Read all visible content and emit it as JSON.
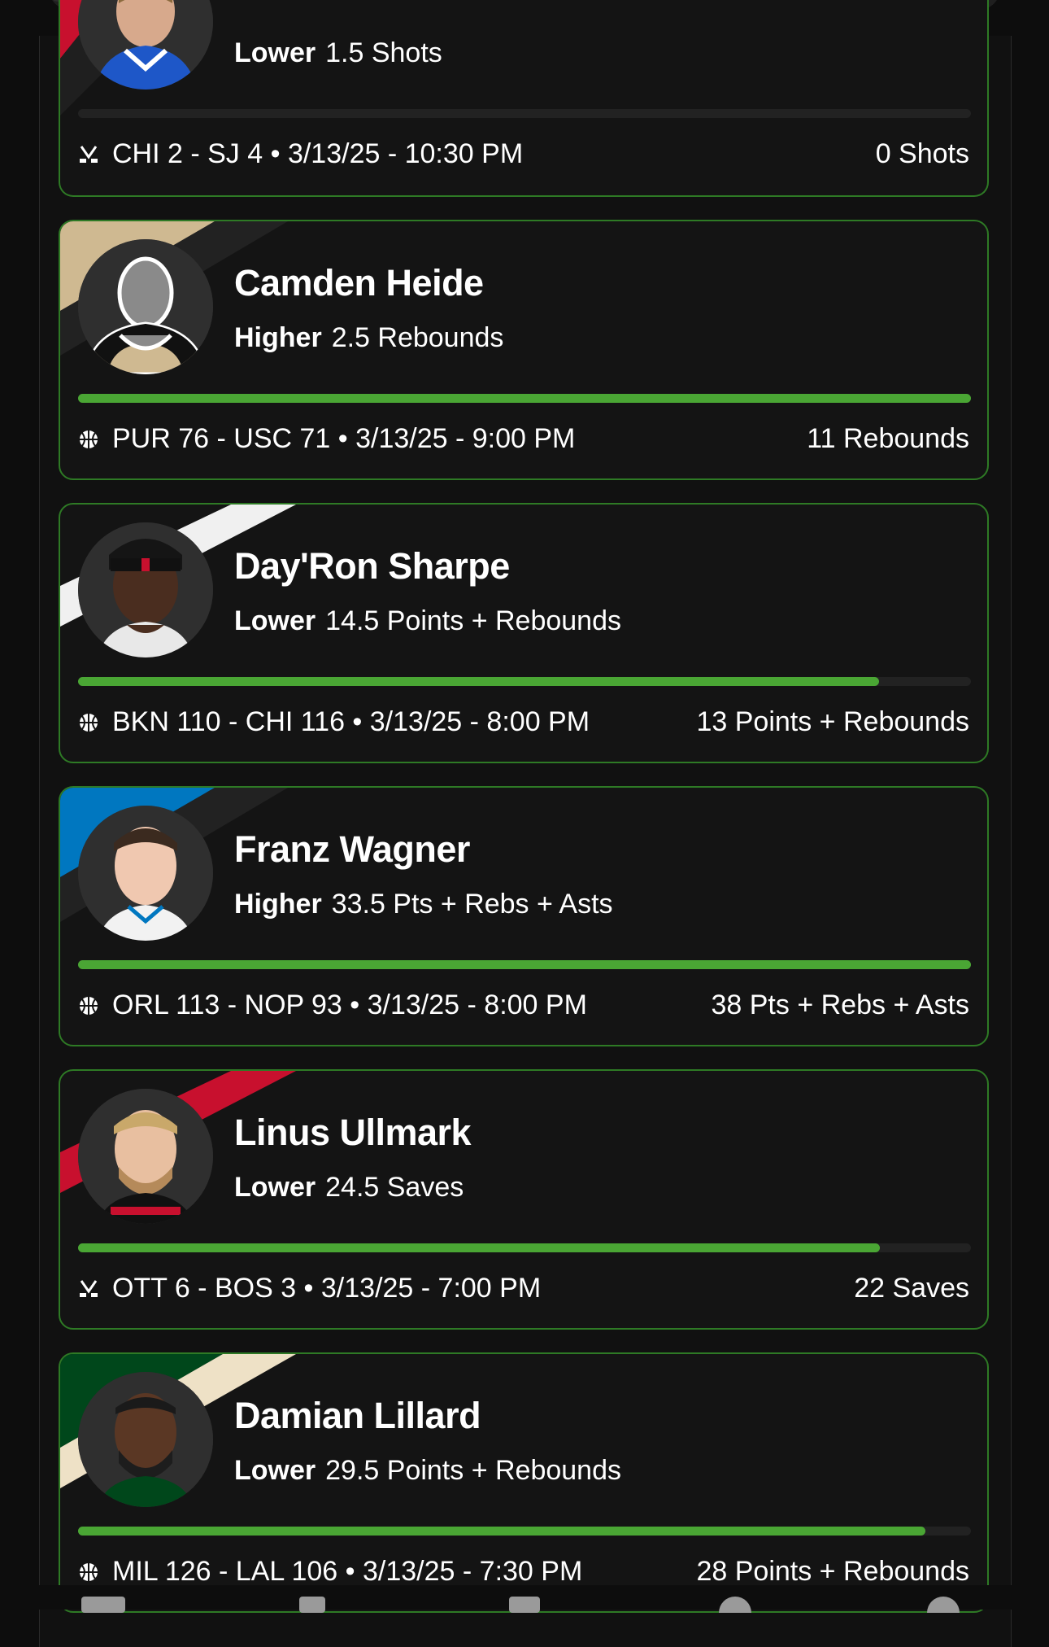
{
  "cards": [
    {
      "name": "",
      "direction": "Lower",
      "line": "1.5 Shots",
      "sport": "hockey-icon",
      "game": "CHI 2 - SJ 4 • 3/13/25 - 10:30 PM",
      "result": "0 Shots",
      "progress": 0.0,
      "stripe_colors": [
        "#c8102e",
        "#1f1f1f"
      ]
    },
    {
      "name": "Camden Heide",
      "direction": "Higher",
      "line": "2.5 Rebounds",
      "sport": "basketball-icon",
      "game": "PUR 76 - USC 71 • 3/13/25 - 9:00 PM",
      "result": "11 Rebounds",
      "progress": 1.0,
      "stripe_colors": [
        "#cfb991",
        "#222222"
      ]
    },
    {
      "name": "Day'Ron Sharpe",
      "direction": "Lower",
      "line": "14.5 Points + Rebounds",
      "sport": "basketball-icon",
      "game": "BKN 110 - CHI 116 • 3/13/25 - 8:00 PM",
      "result": "13 Points + Rebounds",
      "progress": 0.897,
      "stripe_colors": [
        "#f0f0f0",
        "#111111"
      ]
    },
    {
      "name": "Franz Wagner",
      "direction": "Higher",
      "line": "33.5 Pts + Rebs + Asts",
      "sport": "basketball-icon",
      "game": "ORL 113 - NOP 93 • 3/13/25 - 8:00 PM",
      "result": "38 Pts + Rebs + Asts",
      "progress": 1.0,
      "stripe_colors": [
        "#0077c0",
        "#222222"
      ]
    },
    {
      "name": "Linus Ullmark",
      "direction": "Lower",
      "line": "24.5 Saves",
      "sport": "hockey-icon",
      "game": "OTT 6 - BOS 3 • 3/13/25 - 7:00 PM",
      "result": "22 Saves",
      "progress": 0.898,
      "stripe_colors": [
        "#c8102e",
        "#111111"
      ]
    },
    {
      "name": "Damian Lillard",
      "direction": "Lower",
      "line": "29.5 Points + Rebounds",
      "sport": "basketball-icon",
      "game": "MIL 126 - LAL 106 • 3/13/25 - 7:30 PM",
      "result": "28 Points + Rebounds",
      "progress": 0.949,
      "stripe_colors": [
        "#00471b",
        "#eee1c6"
      ]
    }
  ],
  "colors": {
    "accent": "#4aa634",
    "border": "#2e7a25",
    "background": "#0d0d0d",
    "card": "#141414"
  }
}
